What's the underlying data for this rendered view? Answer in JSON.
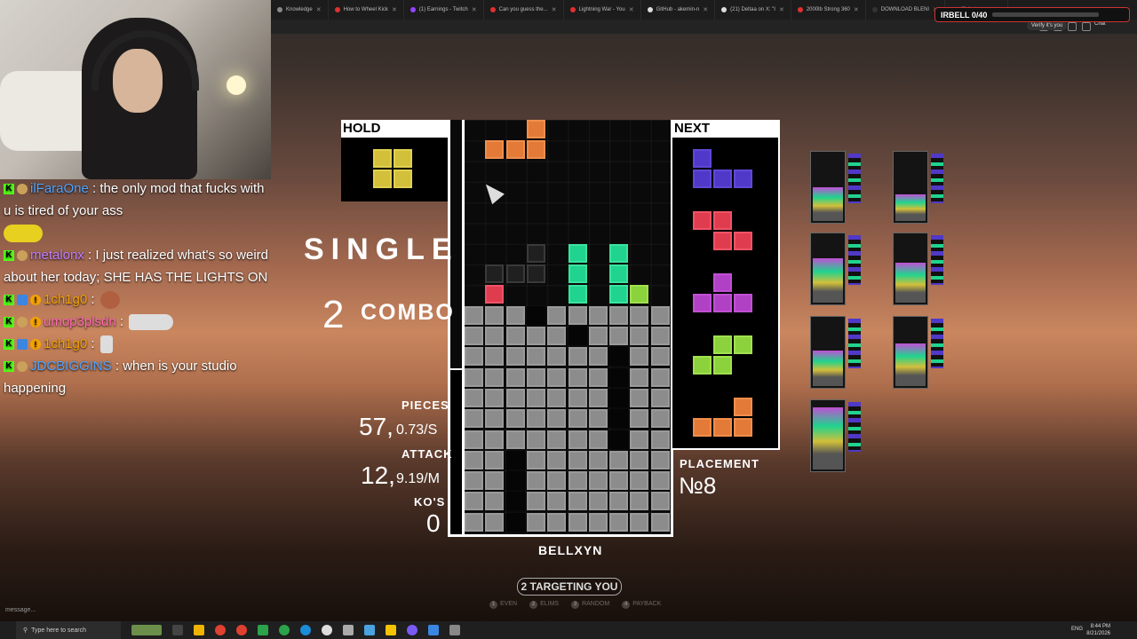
{
  "browser": {
    "tabs": [
      "Knowledge",
      "How to Wheel Kick",
      "(1) Earnings - Twitch",
      "Can you guess the...",
      "Lightning War - You",
      "GitHub - akemin-n",
      "(21) Deltaa on X: \"I",
      "2000lb Strong 360",
      "DOWNLOAD BLENI",
      "(2) Instagram"
    ],
    "verify_label": "Verify it's you",
    "chat_label": "Chat"
  },
  "overlay": {
    "goal_label": "IRBELL 0/40"
  },
  "chat": {
    "messages": [
      {
        "user": "ilFaraOne",
        "color": "#4fa3ff",
        "text": ": the only mod that fucks with u is tired of your ass"
      },
      {
        "user": "metalonx",
        "color": "#c07cff",
        "text": ": I just realized what's so weird about her today; SHE HAS THE LIGHTS ON"
      },
      {
        "user": "1ch1g0",
        "color": "#f5a300",
        "text": ":"
      },
      {
        "user": "umop3plsdn",
        "color": "#ff69b4",
        "text": ":"
      },
      {
        "user": "1ch1g0",
        "color": "#f5a300",
        "text": ":"
      },
      {
        "user": "JDCBIGGINS",
        "color": "#4fa3ff",
        "text": ": when is your studio happening"
      }
    ],
    "input_placeholder": "message..."
  },
  "game": {
    "hold_label": "HOLD",
    "next_label": "NEXT",
    "clear_text": "SINGLE",
    "combo_count": "2",
    "combo_label": "COMBO",
    "pieces_label": "PIECES",
    "pieces_value": "57,",
    "pieces_rate": "0.73/S",
    "attack_label": "ATTACK",
    "attack_value": "12,",
    "attack_rate": "9.19/M",
    "kos_label": "KO'S",
    "kos_value": "0",
    "placement_label": "PLACEMENT",
    "placement_value": "№8",
    "player_name": "BELLXYN",
    "targeting_label": "2 TARGETING YOU",
    "strategies": [
      {
        "key": "1",
        "label": "EVEN"
      },
      {
        "key": "2",
        "label": "ELIMS"
      },
      {
        "key": "3",
        "label": "RANDOM"
      },
      {
        "key": "4",
        "label": "PAYBACK"
      }
    ],
    "hold_piece": "O",
    "next_queue": [
      "J",
      "Z",
      "T",
      "S",
      "L"
    ],
    "colors": {
      "orange": "#e47a38",
      "yellow": "#d2c03a",
      "teal": "#20d38e",
      "red": "#e03c50",
      "lime": "#8cd23c",
      "purple": "#b040c4",
      "blue": "#5038c8",
      "garbage": "#8c8c8c"
    }
  },
  "taskbar": {
    "search_placeholder": "Type here to search",
    "language": "ENG",
    "time": "8:44 PM",
    "date": "8/21/2026"
  }
}
